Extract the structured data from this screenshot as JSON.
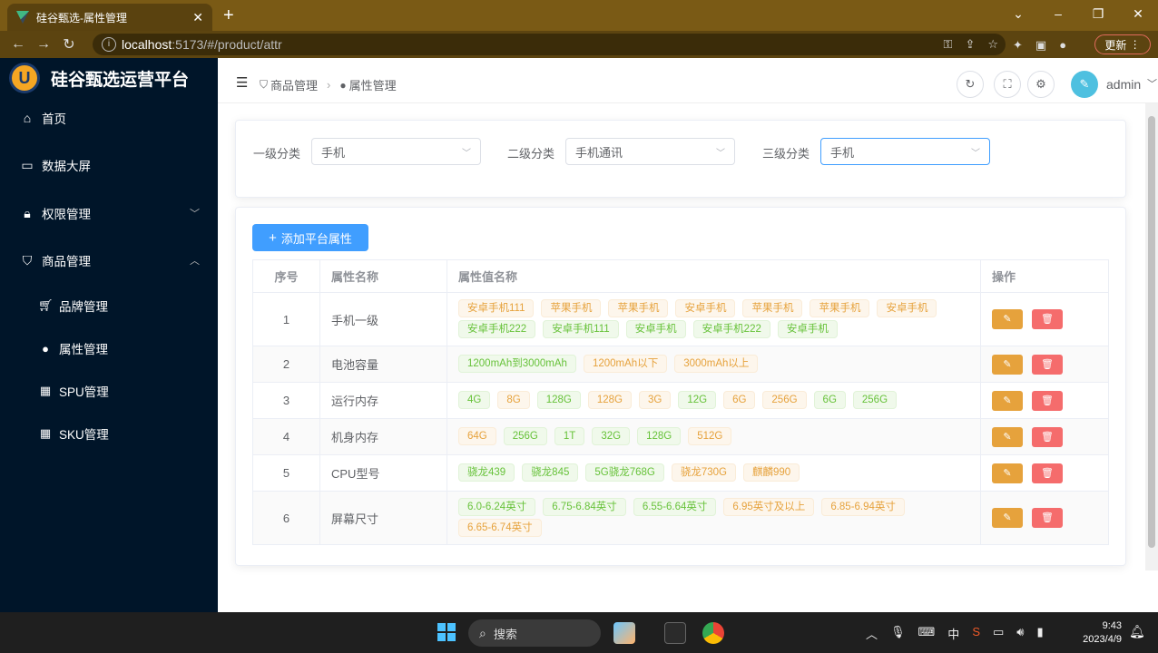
{
  "browser": {
    "tab_title": "硅谷甄选-属性管理",
    "tab_close": "✕",
    "new_tab": "+",
    "url_host": "localhost",
    "url_path": ":5173/#/product/attr",
    "update_label": "更新"
  },
  "sidebar": {
    "logo_text": "硅谷甄选运营平台",
    "logo_letter": "U",
    "items": [
      {
        "label": "首页",
        "icon": "home-icon"
      },
      {
        "label": "数据大屏",
        "icon": "monitor-icon"
      },
      {
        "label": "权限管理",
        "icon": "lock-icon"
      },
      {
        "label": "商品管理",
        "icon": "bag-icon"
      }
    ],
    "sub_items": [
      {
        "label": "品牌管理",
        "icon": "cart-icon"
      },
      {
        "label": "属性管理",
        "icon": "user-icon"
      },
      {
        "label": "SPU管理",
        "icon": "grid-icon"
      },
      {
        "label": "SKU管理",
        "icon": "grid-icon"
      }
    ]
  },
  "header": {
    "breadcrumb": [
      "商品管理",
      "属性管理"
    ],
    "username": "admin"
  },
  "filters": [
    {
      "label": "一级分类",
      "value": "手机"
    },
    {
      "label": "二级分类",
      "value": "手机通讯"
    },
    {
      "label": "三级分类",
      "value": "手机"
    }
  ],
  "add_button": "添加平台属性",
  "table": {
    "headers": [
      "序号",
      "属性名称",
      "属性值名称",
      "操作"
    ],
    "rows": [
      {
        "index": "1",
        "name": "手机一级",
        "values": [
          {
            "t": "安卓手机111",
            "c": "o"
          },
          {
            "t": "苹果手机",
            "c": "o"
          },
          {
            "t": "苹果手机",
            "c": "o"
          },
          {
            "t": "安卓手机",
            "c": "o"
          },
          {
            "t": "苹果手机",
            "c": "o"
          },
          {
            "t": "苹果手机",
            "c": "o"
          },
          {
            "t": "安卓手机",
            "c": "o"
          },
          {
            "t": "安卓手机222",
            "c": "g"
          },
          {
            "t": "安卓手机111",
            "c": "g"
          },
          {
            "t": "安卓手机",
            "c": "g"
          },
          {
            "t": "安卓手机222",
            "c": "g"
          },
          {
            "t": "安卓手机",
            "c": "g"
          }
        ]
      },
      {
        "index": "2",
        "name": "电池容量",
        "values": [
          {
            "t": "1200mAh到3000mAh",
            "c": "g"
          },
          {
            "t": "1200mAh以下",
            "c": "o"
          },
          {
            "t": "3000mAh以上",
            "c": "o"
          }
        ]
      },
      {
        "index": "3",
        "name": "运行内存",
        "values": [
          {
            "t": "4G",
            "c": "g"
          },
          {
            "t": "8G",
            "c": "o"
          },
          {
            "t": "128G",
            "c": "g"
          },
          {
            "t": "128G",
            "c": "o"
          },
          {
            "t": "3G",
            "c": "o"
          },
          {
            "t": "12G",
            "c": "g"
          },
          {
            "t": "6G",
            "c": "o"
          },
          {
            "t": "256G",
            "c": "o"
          },
          {
            "t": "6G",
            "c": "g"
          },
          {
            "t": "256G",
            "c": "g"
          }
        ]
      },
      {
        "index": "4",
        "name": "机身内存",
        "values": [
          {
            "t": "64G",
            "c": "o"
          },
          {
            "t": "256G",
            "c": "g"
          },
          {
            "t": "1T",
            "c": "g"
          },
          {
            "t": "32G",
            "c": "g"
          },
          {
            "t": "128G",
            "c": "g"
          },
          {
            "t": "512G",
            "c": "o"
          }
        ]
      },
      {
        "index": "5",
        "name": "CPU型号",
        "values": [
          {
            "t": "骁龙439",
            "c": "g"
          },
          {
            "t": "骁龙845",
            "c": "g"
          },
          {
            "t": "5G骁龙768G",
            "c": "g"
          },
          {
            "t": "骁龙730G",
            "c": "o"
          },
          {
            "t": "麒麟990",
            "c": "o"
          }
        ]
      },
      {
        "index": "6",
        "name": "屏幕尺寸",
        "values": [
          {
            "t": "6.0-6.24英寸",
            "c": "g"
          },
          {
            "t": "6.75-6.84英寸",
            "c": "g"
          },
          {
            "t": "6.55-6.64英寸",
            "c": "g"
          },
          {
            "t": "6.95英寸及以上",
            "c": "o"
          },
          {
            "t": "6.85-6.94英寸",
            "c": "o"
          },
          {
            "t": "6.65-6.74英寸",
            "c": "o"
          }
        ]
      }
    ]
  },
  "taskbar": {
    "search_label": "搜索",
    "ime": "中",
    "time": "9:43",
    "date": "2023/4/9"
  },
  "colors": {
    "primary": "#409eff",
    "success": "#67c23a",
    "warning": "#e6a23c",
    "danger": "#f56c6c",
    "sidebar": "#001529"
  }
}
